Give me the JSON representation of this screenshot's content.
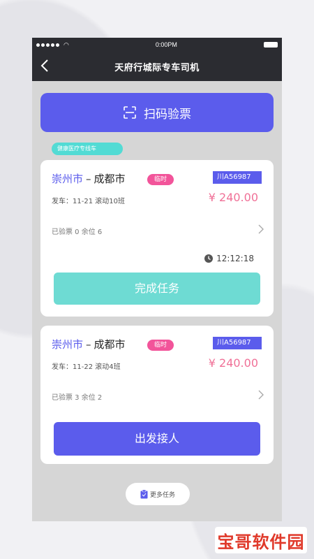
{
  "status": {
    "time": "0:00PM"
  },
  "nav": {
    "title": "天府行城际专车司机"
  },
  "scan": {
    "label": "扫码验票"
  },
  "tag": {
    "label": "健康医疗专线车"
  },
  "tasks": [
    {
      "from": "崇州市",
      "dash": "–",
      "to": "成都市",
      "badge": "临时",
      "plate": "川A56987",
      "depart": "发车：11-21 滚动10班",
      "price": "¥ 240.00",
      "tickets": "已验票 0  余位 6",
      "timer": "12:12:18",
      "action": "完成任务"
    },
    {
      "from": "崇州市",
      "dash": "–",
      "to": "成都市",
      "badge": "临时",
      "plate": "川A56987",
      "depart": "发车：11-22 滚动4班",
      "price": "¥ 240.00",
      "tickets": "已验票 3  余位 2",
      "action": "出发接人"
    }
  ],
  "more": {
    "label": "更多任务"
  },
  "watermark": {
    "text": "宝哥软件园"
  },
  "colors": {
    "primary": "#5b5cec",
    "teal": "#6edbd3",
    "pink": "#f2549a",
    "dark": "#2b2c31"
  }
}
